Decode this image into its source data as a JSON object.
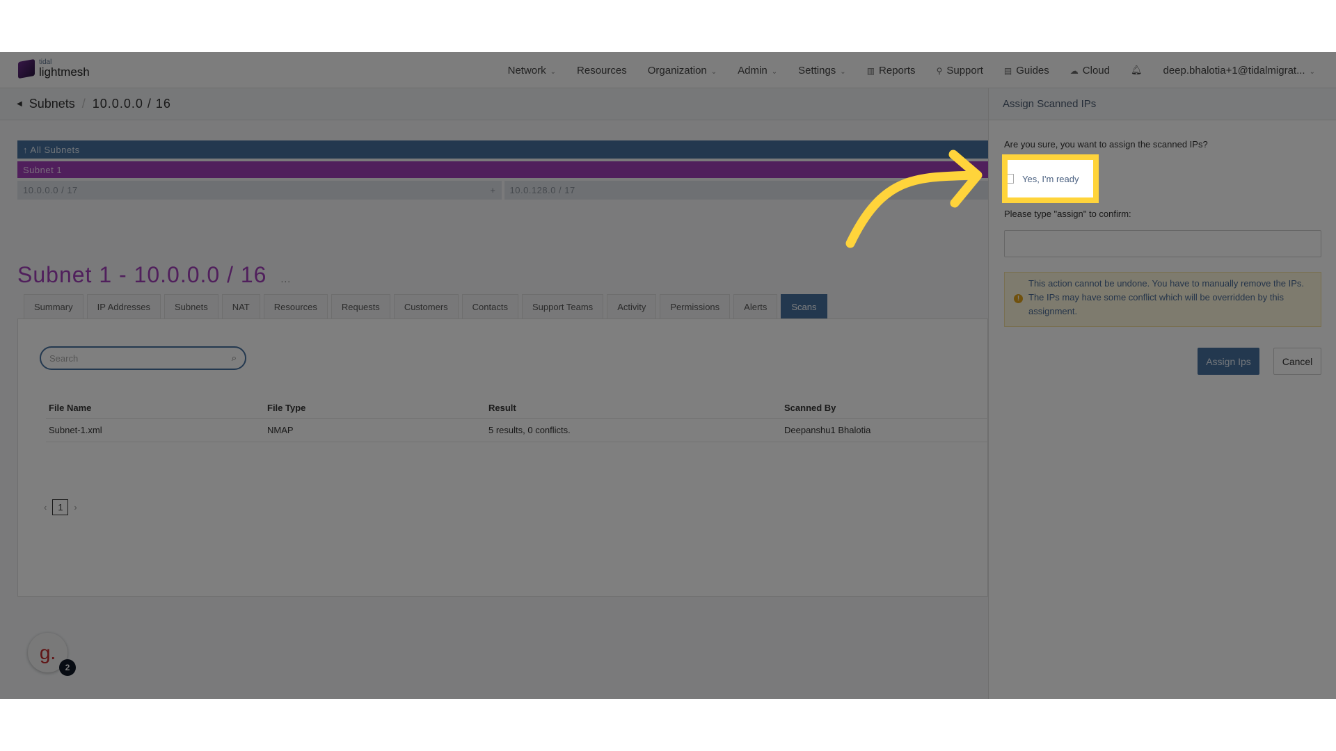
{
  "logo": {
    "small": "tidal",
    "large": "lightmesh"
  },
  "nav": {
    "items": [
      {
        "label": "Network",
        "chevron": true
      },
      {
        "label": "Resources"
      },
      {
        "label": "Organization",
        "chevron": true
      },
      {
        "label": "Admin",
        "chevron": true
      },
      {
        "label": "Settings",
        "chevron": true
      },
      {
        "label": "Reports",
        "icon": "chart-icon"
      },
      {
        "label": "Support",
        "icon": "wrench-icon"
      },
      {
        "label": "Guides",
        "icon": "book-icon"
      },
      {
        "label": "Cloud",
        "icon": "cloud-icon"
      }
    ],
    "user": "deep.bhalotia+1@tidalmigrat..."
  },
  "breadcrumb": {
    "parent": "Subnets",
    "current": "10.0.0.0 / 16"
  },
  "tree": {
    "all": "↑ All Subnets",
    "selected": "Subnet 1",
    "children": [
      "10.0.0.0 / 17",
      "10.0.128.0 / 17"
    ],
    "add": "+"
  },
  "page": {
    "title": "Subnet 1 - 10.0.0.0 / 16",
    "more": "..."
  },
  "tabs": [
    "Summary",
    "IP Addresses",
    "Subnets",
    "NAT",
    "Resources",
    "Requests",
    "Customers",
    "Contacts",
    "Support Teams",
    "Activity",
    "Permissions",
    "Alerts",
    "Scans"
  ],
  "active_tab": "Scans",
  "search": {
    "placeholder": "Search"
  },
  "table": {
    "headers": [
      "File Name",
      "File Type",
      "Result",
      "Scanned By"
    ],
    "rows": [
      [
        "Subnet-1.xml",
        "NMAP",
        "5 results, 0 conflicts.",
        "Deepanshu1 Bhalotia"
      ]
    ]
  },
  "pagination": {
    "page": "1"
  },
  "panel": {
    "title": "Assign Scanned IPs",
    "question": "Are you sure, you want to assign the scanned IPs?",
    "checkbox_label": "Yes, I'm ready",
    "checkbox_checked": false,
    "confirm_label": "Please type \"assign\" to confirm:",
    "confirm_value": "",
    "warning": "This action cannot be undone. You have to manually remove the IPs. The IPs may have some conflict which will be overridden by this assignment.",
    "assign_label": "Assign Ips",
    "cancel_label": "Cancel"
  },
  "help": {
    "glyph": "g.",
    "badge": "2"
  },
  "colors": {
    "accent": "#46719f",
    "brand": "#a03fb8",
    "highlight": "#ffd43b"
  }
}
